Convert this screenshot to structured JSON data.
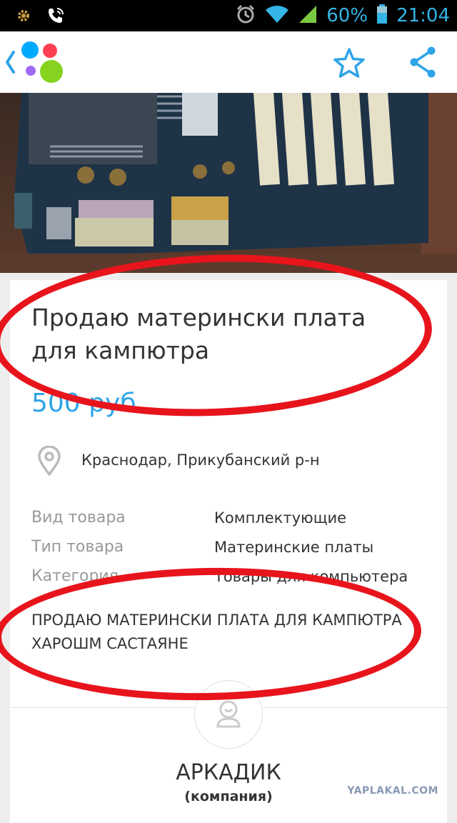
{
  "status_bar": {
    "battery_percent": "60%",
    "time": "21:04",
    "icons": [
      "settings-gear-icon",
      "phone-wifi-icon",
      "alarm-icon",
      "wifi-icon",
      "signal-icon",
      "battery-icon"
    ]
  },
  "app_bar": {
    "icons": [
      "back-chevron-icon",
      "app-logo",
      "star-icon",
      "share-icon"
    ],
    "colors": {
      "accent": "#2fa4e7",
      "logo_blue": "#00aaff",
      "logo_red": "#ff4053",
      "logo_purple": "#a169f7",
      "logo_green": "#85d31f"
    }
  },
  "listing": {
    "title": "Продаю матерински плата для кампютра",
    "price": "500 руб.",
    "location": "Краснодар, Прикубанский р-н",
    "attributes": [
      {
        "key": "Вид товара",
        "value": "Комплектующие"
      },
      {
        "key": "Тип товара",
        "value": "Материнские платы"
      },
      {
        "key": "Категория",
        "value": "Товары для компьютера"
      }
    ],
    "description": "ПРОДАЮ МАТЕРИНСКИ ПЛАТА ДЛЯ КАМПЮТРА ХАРОШМ САСТАЯНЕ"
  },
  "seller": {
    "name": "АРКАДИК",
    "type": "(компания)"
  },
  "watermark": "YAPLAKAL.COM"
}
